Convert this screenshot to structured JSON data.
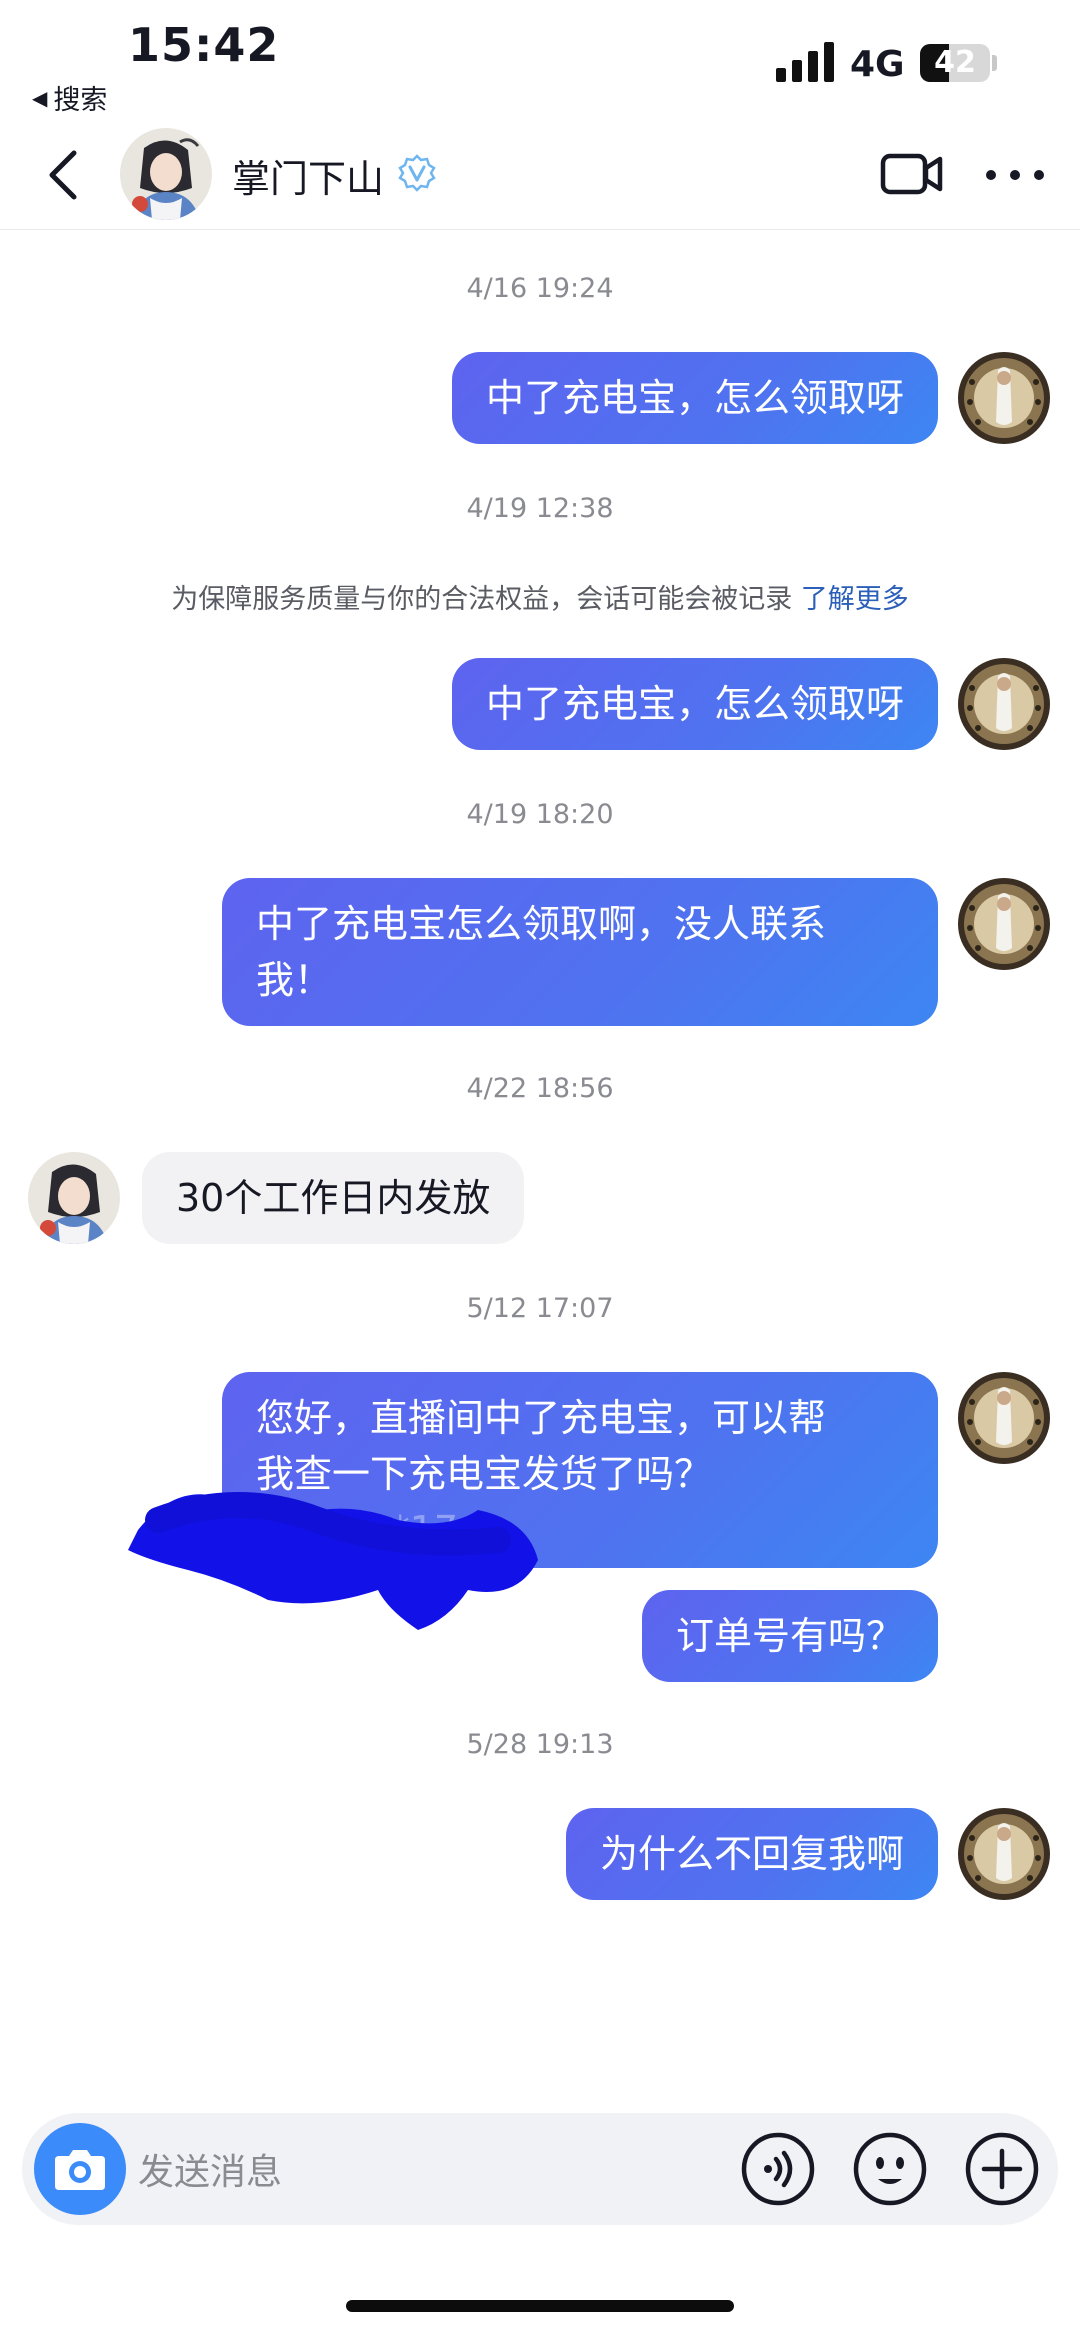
{
  "status": {
    "time": "15:42",
    "back_app": "搜索",
    "network": "4G",
    "battery": "42",
    "battery_fraction": 0.42
  },
  "header": {
    "contact_name": "掌门下山",
    "verified": true
  },
  "messages": {
    "ts1": "4/16 19:24",
    "m1": "中了充电宝，怎么领取呀",
    "ts2": "4/19 12:38",
    "notice": "为保障服务质量与你的合法权益，会话可能会被记录",
    "notice_link": "了解更多",
    "m2": "中了充电宝，怎么领取呀",
    "ts3": "4/19 18:20",
    "m3_line1": "中了充电宝怎么领取啊，没人联系",
    "m3_line2": "我！",
    "ts4": "4/22 18:56",
    "m4": "30个工作日内发放",
    "ts5": "5/12 17:07",
    "m5_line1": "您好，直播间中了充电宝，可以帮",
    "m5_line2": "我查一下充电宝发货了吗？",
    "m5_line3": "2663***174",
    "m6": "订单号有吗？",
    "ts6": "5/28 19:13",
    "m7": "为什么不回复我啊"
  },
  "input": {
    "placeholder": "发送消息"
  },
  "colors": {
    "outgoing_bubble": "#5566f0",
    "incoming_bubble": "#f2f2f4",
    "camera_button": "#3b8bfa",
    "link": "#2b5fb8"
  },
  "icons": [
    "back-chevron-icon",
    "verified-icon",
    "video-call-icon",
    "more-icon",
    "camera-icon",
    "voice-icon",
    "emoji-icon",
    "plus-icon"
  ]
}
